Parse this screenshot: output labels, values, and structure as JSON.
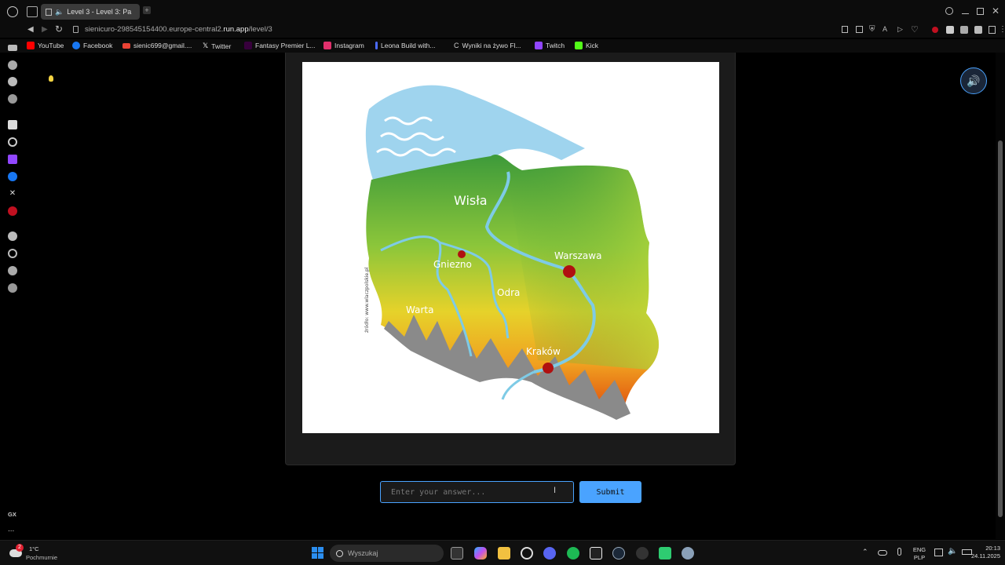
{
  "browser": {
    "tab_title": "Level 3 - Level 3: Pa",
    "url_host": "sienicuro-298545154400.europe-central2.",
    "url_bold": "run.app",
    "url_path": "/level/3"
  },
  "bookmarks": [
    {
      "label": "YouTube",
      "color": "#ff0000"
    },
    {
      "label": "Facebook",
      "color": "#1877f2"
    },
    {
      "label": "sienic699@gmail....",
      "color": "#ea4335"
    },
    {
      "label": "Twitter",
      "color": "#ffffff"
    },
    {
      "label": "Fantasy Premier L...",
      "color": "#37003c"
    },
    {
      "label": "Instagram",
      "color": "#e1306c"
    },
    {
      "label": "Leona Build with...",
      "color": "#4b6bff"
    },
    {
      "label": "Wyniki na żywo Fl...",
      "color": "#333333"
    },
    {
      "label": "Twitch",
      "color": "#9146ff"
    },
    {
      "label": "Kick",
      "color": "#53fc18"
    }
  ],
  "map": {
    "labels": {
      "wisla": "Wisła",
      "gniezno": "Gniezno",
      "warszawa": "Warszawa",
      "odra": "Odra",
      "warta": "Warta",
      "krakow": "Kraków"
    },
    "source": "źródło: www.wlaczpolskie.pl"
  },
  "answer": {
    "placeholder": "Enter your answer...",
    "submit_label": "Submit"
  },
  "sidebar_bottom": {
    "gx_label": "GX",
    "more_label": "..."
  },
  "taskbar": {
    "weather_temp": "1°C",
    "weather_desc": "Pochmurnie",
    "weather_badge": "2",
    "search_placeholder": "Wyszukaj",
    "lang_top": "ENG",
    "lang_bottom": "PLP",
    "time": "20:13",
    "date": "24.11.2025"
  },
  "colors": {
    "accent": "#4aa3ff",
    "city_dot": "#b01010"
  }
}
